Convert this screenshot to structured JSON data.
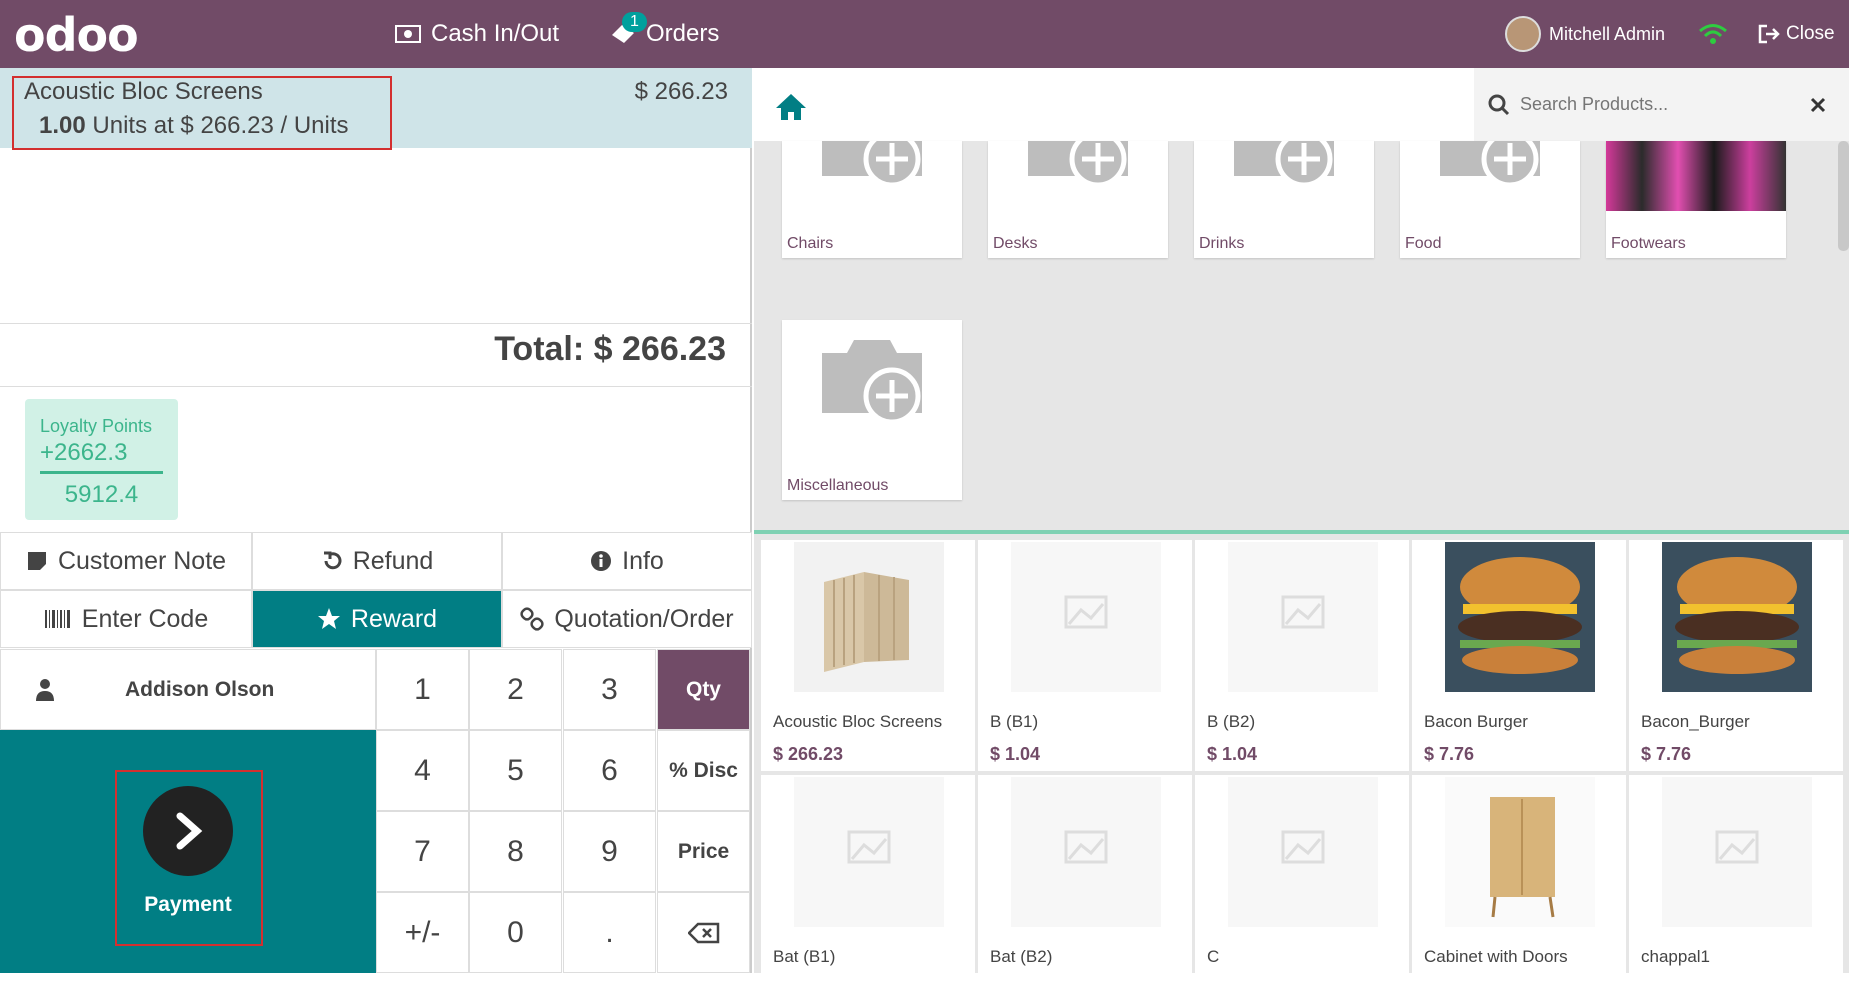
{
  "topbar": {
    "logo": "odoo",
    "cash_label": "Cash In/Out",
    "orders_label": "Orders",
    "orders_badge": "1",
    "user_name": "Mitchell Admin",
    "close_label": "Close"
  },
  "order": {
    "line_name": "Acoustic Bloc Screens",
    "line_qty": "1.00",
    "line_detail": "Units at $ 266.23 / Units",
    "line_price": "$ 266.23",
    "total_label": "Total: $ 266.23",
    "loyalty_title": "Loyalty Points",
    "loyalty_won": "+2662.3",
    "loyalty_total": "5912.4"
  },
  "controls": {
    "customer_note": "Customer Note",
    "refund": "Refund",
    "info": "Info",
    "enter_code": "Enter Code",
    "reward": "Reward",
    "quotation": "Quotation/Order",
    "customer": "Addison Olson",
    "payment": "Payment"
  },
  "numpad": {
    "k1": "1",
    "k2": "2",
    "k3": "3",
    "qty": "Qty",
    "k4": "4",
    "k5": "5",
    "k6": "6",
    "disc": "% Disc",
    "k7": "7",
    "k8": "8",
    "k9": "9",
    "price": "Price",
    "pm": "+/-",
    "k0": "0",
    "dot": "."
  },
  "search": {
    "placeholder": "Search Products..."
  },
  "categories": [
    "Chairs",
    "Desks",
    "Drinks",
    "Food",
    "Footwears",
    "Miscellaneous"
  ],
  "products": [
    {
      "name": "Acoustic Bloc Screens",
      "price": "$ 266.23"
    },
    {
      "name": "B (B1)",
      "price": "$ 1.04"
    },
    {
      "name": "B (B2)",
      "price": "$ 1.04"
    },
    {
      "name": "Bacon Burger",
      "price": "$ 7.76"
    },
    {
      "name": "Bacon_Burger",
      "price": "$ 7.76"
    },
    {
      "name": "Bat (B1)",
      "price": ""
    },
    {
      "name": "Bat (B2)",
      "price": ""
    },
    {
      "name": "C",
      "price": ""
    },
    {
      "name": "Cabinet with Doors",
      "price": ""
    },
    {
      "name": "chappal1",
      "price": ""
    }
  ],
  "colors": {
    "brand": "#714B67",
    "teal": "#017e84",
    "highlight": "#cfe4e8"
  }
}
